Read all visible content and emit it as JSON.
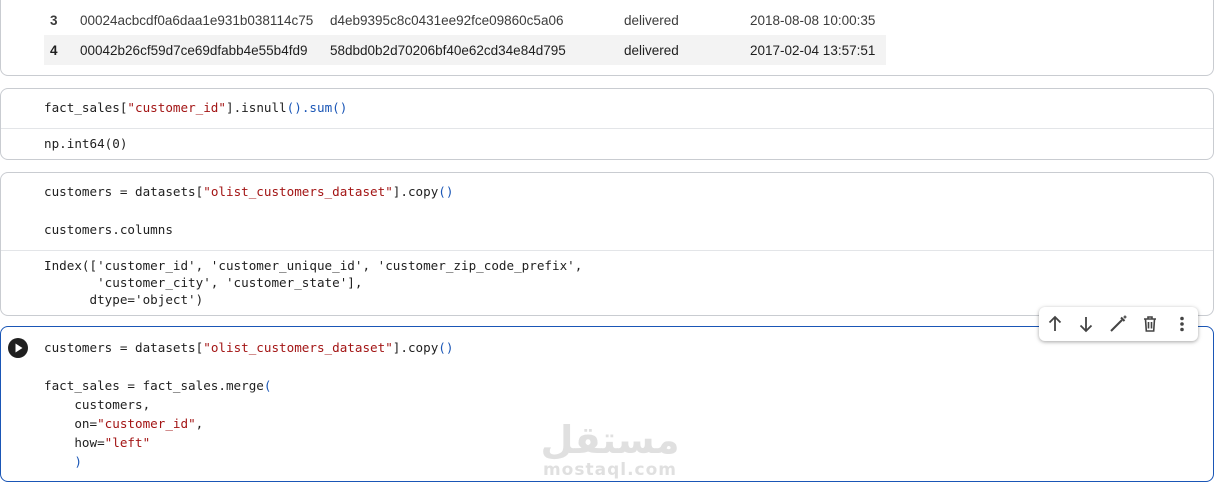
{
  "output_table": {
    "rows": [
      {
        "index": "3",
        "order_id": "00024acbcdf0a6daa1e931b038114c75",
        "customer_id": "d4eb9395c8c0431ee92fce09860c5a06",
        "status": "delivered",
        "timestamp": "2018-08-08 10:00:35"
      },
      {
        "index": "4",
        "order_id": "00042b26cf59d7ce69dfabb4e55b4fd9",
        "customer_id": "58dbd0b2d70206bf40e62cd34e84d795",
        "status": "delivered",
        "timestamp": "2017-02-04 13:57:51"
      }
    ]
  },
  "cell_isnull": {
    "code": {
      "p1": "fact_sales[",
      "s1": "\"customer_id\"",
      "p2": "].isnull",
      "p3": "().sum()"
    },
    "output": "np.int64(0)"
  },
  "cell_columns": {
    "line1": {
      "a": "customers = datasets[",
      "s": "\"olist_customers_dataset\"",
      "b": "].copy",
      "c": "()"
    },
    "line2": "customers.columns",
    "output": [
      "Index(['customer_id', 'customer_unique_id', 'customer_zip_code_prefix',",
      "       'customer_city', 'customer_state'],",
      "      dtype='object')"
    ]
  },
  "cell_merge": {
    "line1": {
      "a": "customers = datasets[",
      "s": "\"olist_customers_dataset\"",
      "b": "].copy",
      "c": "()"
    },
    "line2": {
      "a": "fact_sales = fact_sales.merge",
      "b": "("
    },
    "line3": "    customers,",
    "line4": {
      "a": "    on=",
      "s": "\"customer_id\"",
      "b": ","
    },
    "line5": {
      "a": "    how=",
      "s": "\"left\""
    },
    "line6": "    )"
  },
  "toolbar": {
    "icons": [
      "arrow-up-icon",
      "arrow-down-icon",
      "magic-edit-icon",
      "trash-icon",
      "more-vert-icon"
    ]
  },
  "watermark": {
    "arabic": "مستقل",
    "latin": "mostaql.com"
  },
  "colors": {
    "string": "#a31515",
    "paren": "#1a56b6",
    "active_border": "#1a56b6"
  }
}
